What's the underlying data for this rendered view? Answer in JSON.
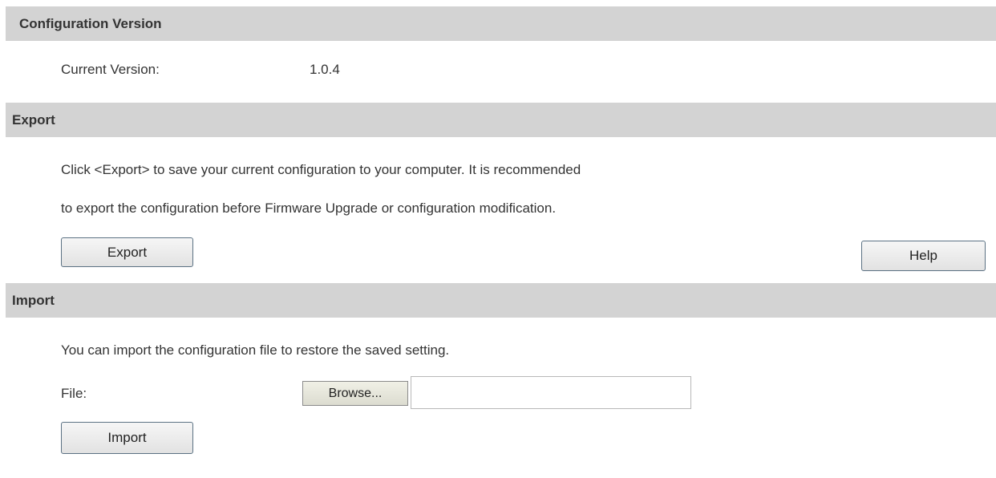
{
  "config_version": {
    "header": "Configuration Version",
    "current_version_label": "Current Version:",
    "current_version_value": "1.0.4"
  },
  "export": {
    "header": "Export",
    "description_line1": "Click <Export> to save your current configuration to your computer. It is recommended",
    "description_line2": "to export the configuration before Firmware Upgrade or configuration modification.",
    "export_button": "Export",
    "help_button": "Help"
  },
  "import": {
    "header": "Import",
    "description": "You can import the configuration file to restore the saved setting.",
    "file_label": "File:",
    "browse_button": "Browse...",
    "file_value": "",
    "import_button": "Import"
  }
}
